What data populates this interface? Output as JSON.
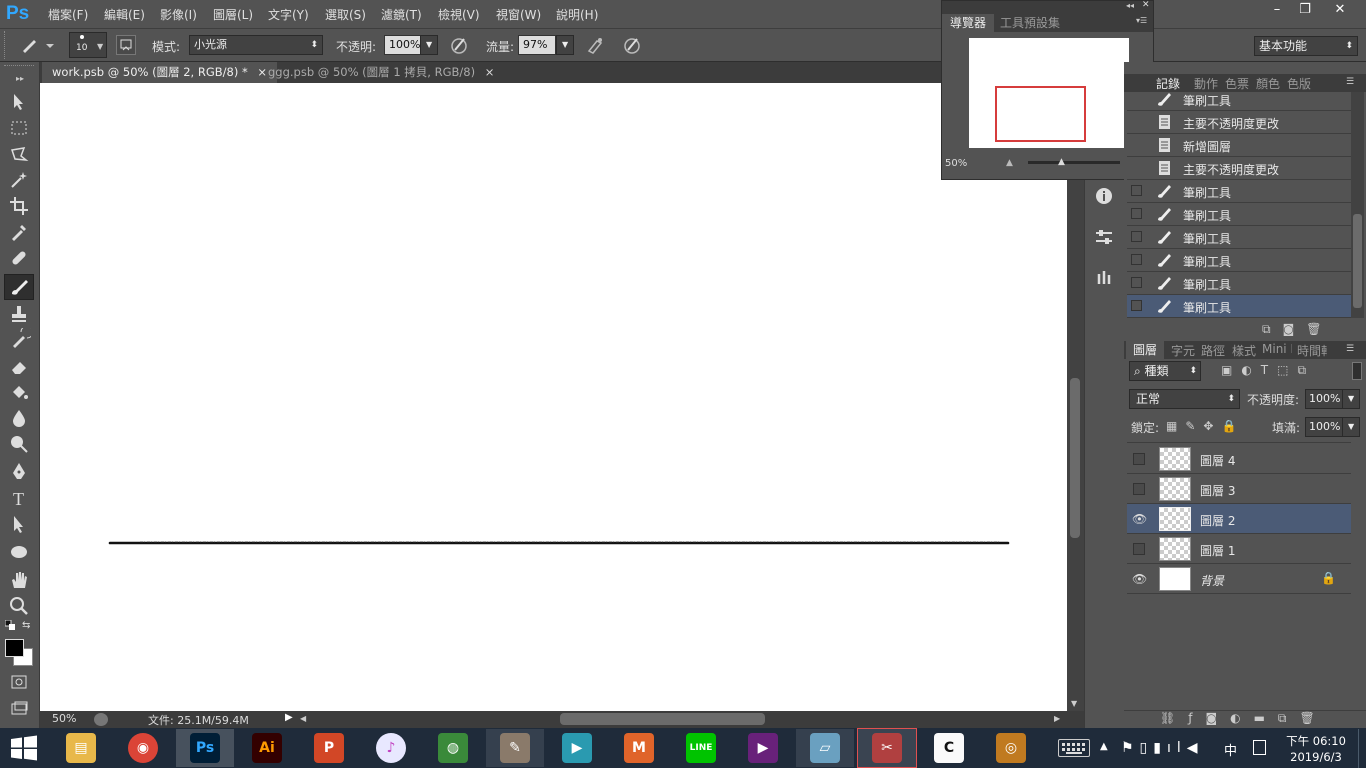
{
  "app": {
    "logo": "Ps"
  },
  "menu": [
    "檔案(F)",
    "編輯(E)",
    "影像(I)",
    "圖層(L)",
    "文字(Y)",
    "選取(S)",
    "濾鏡(T)",
    "檢視(V)",
    "視窗(W)",
    "說明(H)"
  ],
  "window_controls": {
    "minimize": "–",
    "restore": "❐",
    "close": "✕"
  },
  "options": {
    "brush_size": "10",
    "mode_label": "模式:",
    "mode_value": "小光源",
    "opacity_label": "不透明:",
    "opacity_value": "100%",
    "flow_label": "流量:",
    "flow_value": "97%",
    "workspace": "基本功能"
  },
  "tabs": [
    {
      "label": "work.psb @ 50% (圖層 2, RGB/8) *",
      "close": "×",
      "active": true
    },
    {
      "label": "ggg.psb @ 50% (圖層 1 拷貝, RGB/8)",
      "close": "×",
      "active": false
    }
  ],
  "status": {
    "zoom": "50%",
    "doc_info": "文件: 25.1M/59.4M"
  },
  "navigator": {
    "tabs": [
      "導覽器",
      "工具預設集"
    ],
    "zoom": "50%"
  },
  "history": {
    "tabs": [
      "記錄",
      "動作",
      "色票",
      "顏色",
      "色版"
    ],
    "items": [
      {
        "label": "筆刷工具",
        "icon": "brush-icon"
      },
      {
        "label": "主要不透明度更改",
        "icon": "document-icon"
      },
      {
        "label": "新增圖層",
        "icon": "document-icon"
      },
      {
        "label": "主要不透明度更改",
        "icon": "document-icon"
      },
      {
        "label": "筆刷工具",
        "icon": "brush-icon"
      },
      {
        "label": "筆刷工具",
        "icon": "brush-icon"
      },
      {
        "label": "筆刷工具",
        "icon": "brush-icon"
      },
      {
        "label": "筆刷工具",
        "icon": "brush-icon"
      },
      {
        "label": "筆刷工具",
        "icon": "brush-icon"
      },
      {
        "label": "筆刷工具",
        "icon": "brush-icon",
        "selected": true
      }
    ]
  },
  "layers": {
    "tabs": [
      "圖層",
      "字元",
      "路徑",
      "樣式",
      "Mini B",
      "時間軸"
    ],
    "filter_label": "種類",
    "blend_mode": "正常",
    "opacity_label": "不透明度:",
    "opacity_value": "100%",
    "lock_label": "鎖定:",
    "fill_label": "填滿:",
    "fill_value": "100%",
    "items": [
      {
        "name": "圖層 4",
        "visible": false
      },
      {
        "name": "圖層 3",
        "visible": false
      },
      {
        "name": "圖層 2",
        "visible": true,
        "selected": true
      },
      {
        "name": "圖層 1",
        "visible": false
      },
      {
        "name": "背景",
        "visible": true,
        "locked": true
      }
    ]
  },
  "taskbar": {
    "apps": [
      "windows-explorer",
      "chrome",
      "photoshop",
      "illustrator",
      "powerpoint",
      "itunes",
      "maps",
      "sketch",
      "video",
      "mega",
      "line",
      "visual-studio",
      "notes",
      "snipping",
      "clip-studio",
      "media"
    ],
    "ime": "中",
    "time_line1": "下午 06:10",
    "time_line2": "2019/6/3"
  },
  "colors": {
    "accent": "#31a8ff",
    "selected_row": "#4b5b76",
    "panel": "#535353",
    "dark": "#3c3c3c"
  }
}
